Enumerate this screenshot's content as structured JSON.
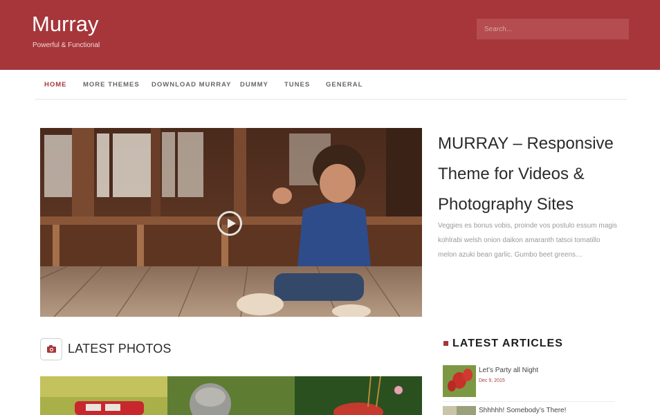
{
  "site": {
    "title": "Murray",
    "tagline": "Powerful & Functional"
  },
  "search": {
    "placeholder": "Search..."
  },
  "nav": {
    "items": [
      {
        "label": "HOME",
        "active": true
      },
      {
        "label": "MORE THEMES",
        "active": false
      },
      {
        "label": "DOWNLOAD MURRAY",
        "active": false
      },
      {
        "label": "DUMMY",
        "active": false
      },
      {
        "label": "TUNES",
        "active": false
      },
      {
        "label": "GENERAL",
        "active": false
      }
    ]
  },
  "featured": {
    "title": "MURRAY – Responsive Theme for Videos & Photography Sites",
    "excerpt": "Veggies es bonus vobis, proinde vos postulo essum magis kohlrabi welsh onion daikon amaranth tatsoi tomatillo melon azuki bean garlic. Gumbo beet greens…",
    "icon": "play-icon"
  },
  "latest_photos": {
    "heading": "LATEST PHOTOS",
    "icon": "camera-icon"
  },
  "latest_articles": {
    "heading": "LATEST ARTICLES",
    "items": [
      {
        "title": "Let’s Party all Night",
        "date": "Dec 9, 2015"
      },
      {
        "title": "Shhhhh! Somebody’s There!",
        "date": ""
      }
    ]
  },
  "colors": {
    "brand": "#a6363a",
    "header_bg": "#a6363a",
    "date_accent": "#a6363a"
  }
}
